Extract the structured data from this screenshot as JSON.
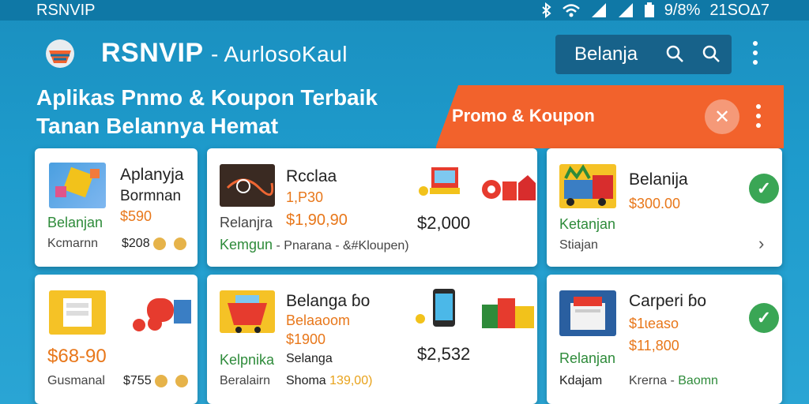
{
  "status": {
    "app": "RSNVIP",
    "battery": "9/8%",
    "time": "21SOΔ7"
  },
  "header": {
    "title": "RSNVIP",
    "subtitle": "- AurlosoKaul",
    "search_text": "Belanja"
  },
  "headline": {
    "line1": "Aplikas Pnmo & Koupon Terbaik",
    "line2": "Tanan Belannya Hemat"
  },
  "promo": {
    "label": "Promo & Koupon"
  },
  "cards": {
    "c1": {
      "name1": "Aplanyja",
      "name2": "Bormnan",
      "price": "$590",
      "tag": "Belanjan",
      "seller": "Kcmarnn",
      "amount": "$208"
    },
    "c2": {
      "name": "Rcclaa",
      "price_old": "1,P30",
      "label": "Relanjra",
      "price": "$1,90,90",
      "total": "$2,000",
      "footer_green": "Kemgun",
      "footer_rest": "- Pnarana - &#Kloupen)"
    },
    "c3": {
      "name": "Belanija",
      "price": "$300.00",
      "tag": "Ketanjan",
      "seller": "Stiajan"
    },
    "c4": {
      "price": "$68-90",
      "seller": "Gusmanal",
      "amount": "$755"
    },
    "c5": {
      "name": "Belanga ɓo",
      "sub": "Belaaoom",
      "price": "$1900",
      "total": "$2,532",
      "tag": "Kelpnika",
      "label": "Selanga",
      "footer1": "Beralairn",
      "footer2": "Shoma",
      "footer3": "139,00)"
    },
    "c6": {
      "name": "Carperi ɓo",
      "price1": "$1ɩeaso",
      "price2": "$11,800",
      "tag": "Relanjan",
      "seller": "Kdajam",
      "footer_rest": "Krerna -",
      "footer_green": "Baomn"
    }
  },
  "colors": {
    "background": "#1e9bcc",
    "status_bar": "#0f78a6",
    "search_box": "#17628a",
    "promo_orange": "#f2622c",
    "price_orange": "#e8771a",
    "tag_green": "#2e8b3a",
    "check_green": "#3aa655"
  }
}
